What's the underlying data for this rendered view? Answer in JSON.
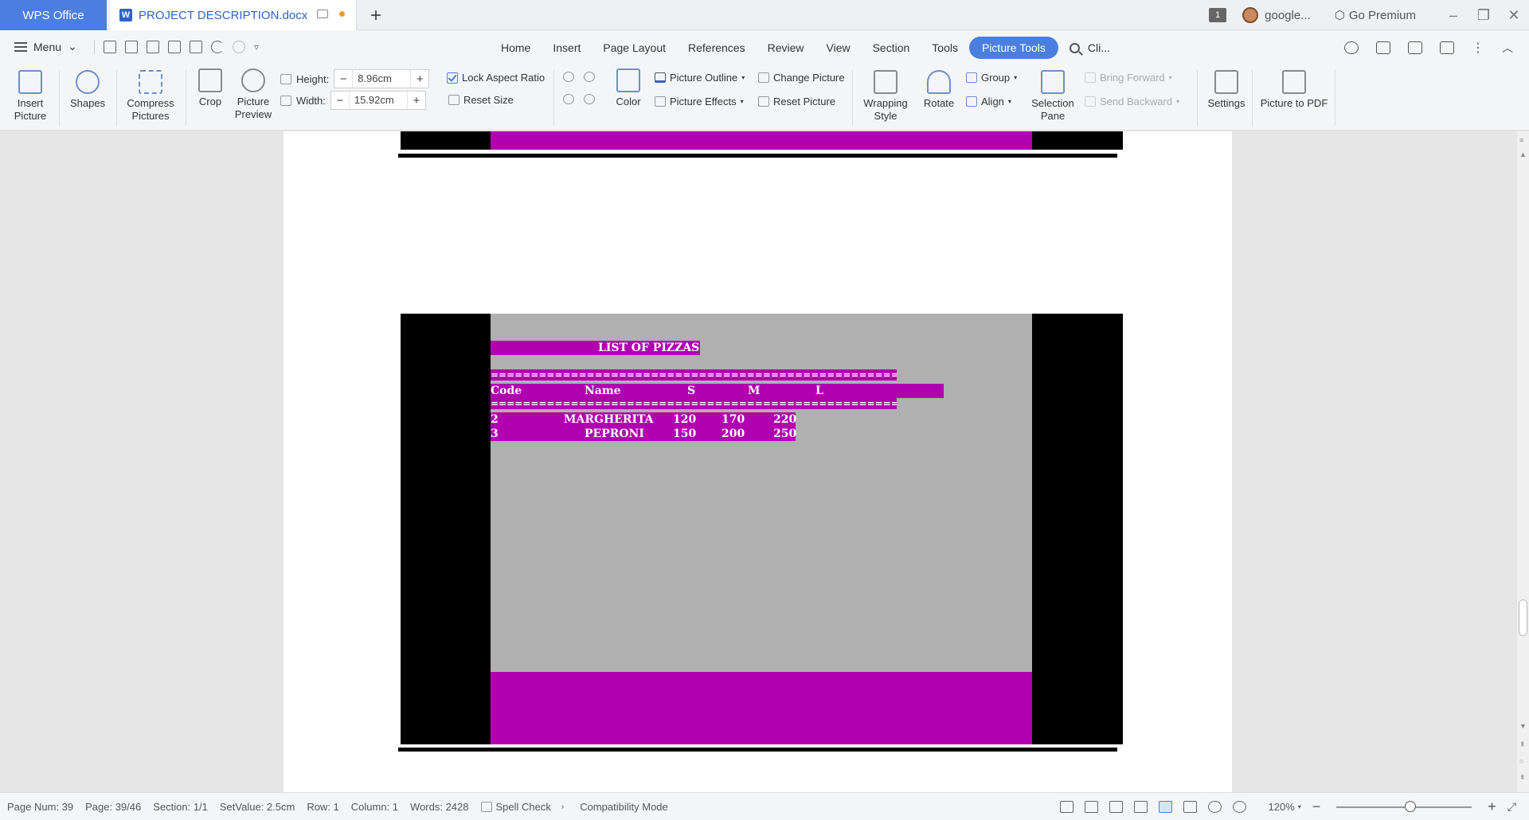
{
  "titlebar": {
    "app_tab": "WPS Office",
    "doc_tab": "PROJECT DESCRIPTION.docx",
    "doc_icon_letter": "W",
    "count_badge": "1",
    "account": "google...",
    "premium": "Go Premium"
  },
  "menubar": {
    "menu_label": "Menu",
    "tabs": [
      "Home",
      "Insert",
      "Page Layout",
      "References",
      "Review",
      "View",
      "Section",
      "Tools",
      "Picture Tools"
    ],
    "active_tab": "Picture Tools",
    "search_label": "Cli..."
  },
  "ribbon": {
    "insert_picture": "Insert\nPicture",
    "shapes": "Shapes",
    "compress_pictures": "Compress\nPictures",
    "crop": "Crop",
    "picture_preview": "Picture\nPreview",
    "height_label": "Height:",
    "height_value": "8.96cm",
    "width_label": "Width:",
    "width_value": "15.92cm",
    "lock_aspect": "Lock Aspect Ratio",
    "reset_size": "Reset Size",
    "color": "Color",
    "picture_outline": "Picture Outline",
    "picture_effects": "Picture Effects",
    "change_picture": "Change Picture",
    "reset_picture": "Reset Picture",
    "wrapping_style": "Wrapping\nStyle",
    "rotate": "Rotate",
    "group": "Group",
    "align": "Align",
    "selection_pane": "Selection\nPane",
    "bring_forward": "Bring Forward",
    "send_backward": "Send Backward",
    "settings": "Settings",
    "picture_to_pdf": "Picture to PDF"
  },
  "document": {
    "screen_title": "LIST OF PIZZAS",
    "separator": "=========================================================",
    "headers": {
      "code": "Code",
      "name": "Name",
      "s": "S",
      "m": "M",
      "l": "L"
    },
    "rows": [
      {
        "code": "2",
        "name": "MARGHERITA",
        "s": "120",
        "m": "170",
        "l": "220"
      },
      {
        "code": "3",
        "name": "PEPRONI",
        "s": "150",
        "m": "200",
        "l": "250"
      }
    ]
  },
  "statusbar": {
    "page_num": "Page Num: 39",
    "page": "Page: 39/46",
    "section": "Section: 1/1",
    "set_value": "SetValue: 2.5cm",
    "row": "Row: 1",
    "column": "Column: 1",
    "words": "Words: 2428",
    "spell_check": "Spell Check",
    "compat_mode": "Compatibility Mode",
    "zoom": "120%"
  },
  "colors": {
    "accent": "#4a7fe0",
    "dos_magenta": "#b000b0",
    "dos_gray": "#b0b0b0"
  }
}
